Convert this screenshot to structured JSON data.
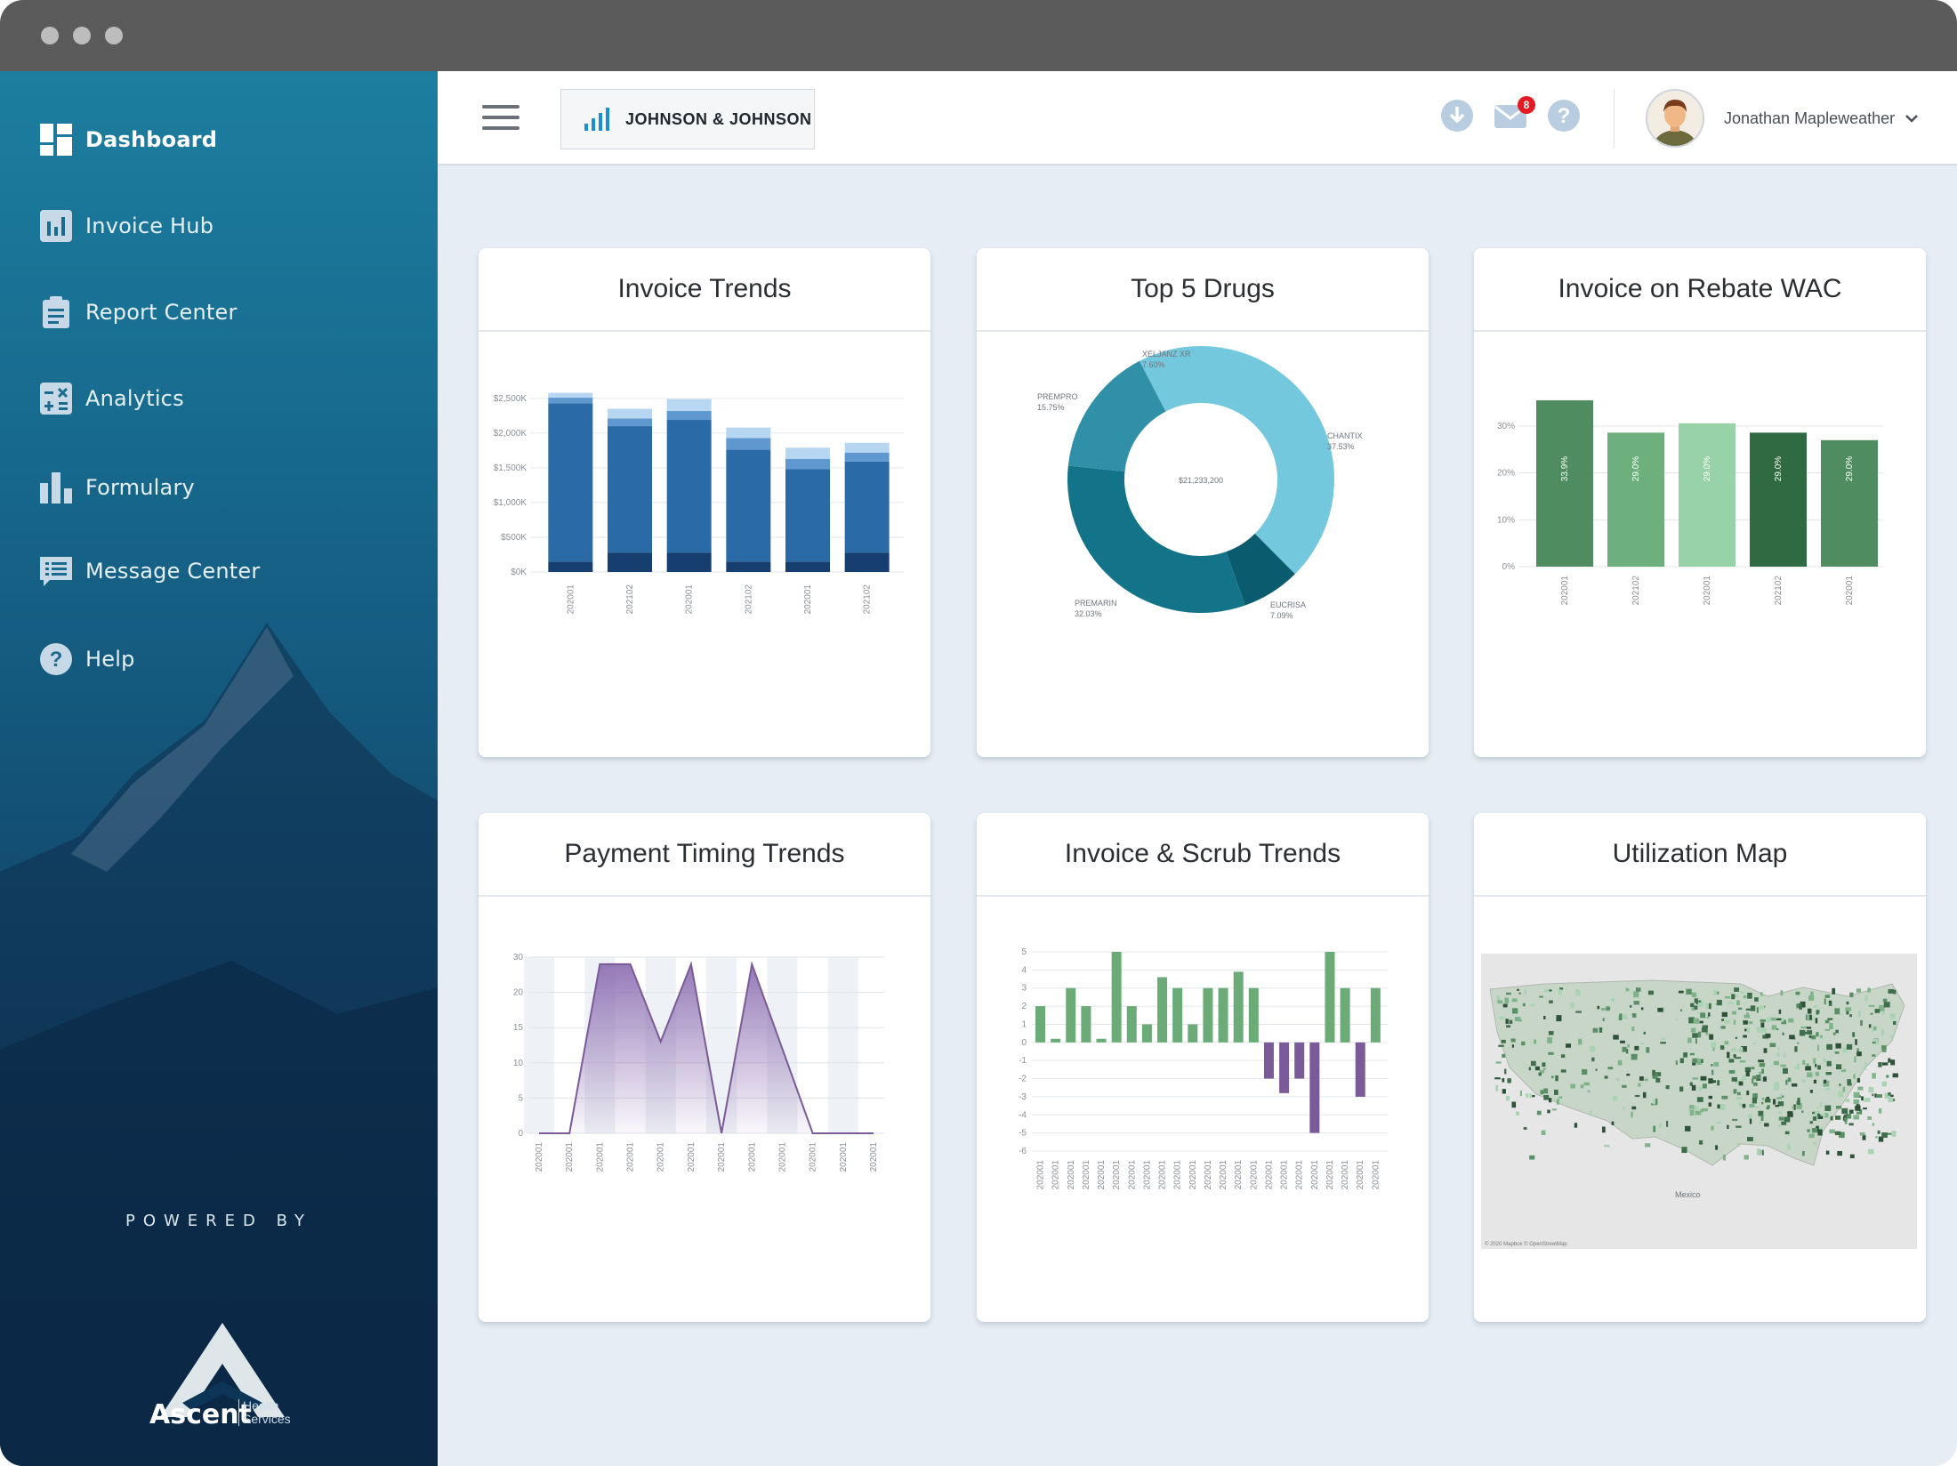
{
  "window": {
    "traffic_lights": [
      "close",
      "minimize",
      "zoom"
    ]
  },
  "sidebar": {
    "items": [
      {
        "label": "Dashboard",
        "icon": "dashboard-icon",
        "active": true
      },
      {
        "label": "Invoice Hub",
        "icon": "invoice-hub-icon",
        "active": false
      },
      {
        "label": "Report Center",
        "icon": "report-center-icon",
        "active": false
      },
      {
        "label": "Analytics",
        "icon": "analytics-icon",
        "active": false
      },
      {
        "label": "Formulary",
        "icon": "formulary-icon",
        "active": false
      },
      {
        "label": "Message Center",
        "icon": "message-center-icon",
        "active": false
      },
      {
        "label": "Help",
        "icon": "help-icon",
        "active": false
      }
    ],
    "powered_by": "POWERED BY",
    "brand": {
      "name": "Ascent",
      "sub_line1": "Health",
      "sub_line2": "Services"
    }
  },
  "header": {
    "company": "JOHNSON & JOHNSON",
    "notifications_count": "8",
    "user_name": "Jonathan Mapleweather",
    "icons": [
      "menu-icon",
      "download-icon",
      "mail-icon",
      "help-circle-icon",
      "chevron-down-icon"
    ]
  },
  "colors": {
    "accent": "#1a8fd0",
    "blue_stack": [
      "#163f70",
      "#2a6aa6",
      "#5f97cf",
      "#b7d6f2"
    ],
    "donut": [
      "#74c8de",
      "#0b5b6e",
      "#137489",
      "#2f90a8"
    ],
    "green_bars": [
      "#4f8c5f",
      "#6daf7d",
      "#97d2a8",
      "#2f6a42",
      "#4f8c5f"
    ],
    "purple": "#8a6bb0",
    "green": "#6bab78",
    "violet": "#7a5a98"
  },
  "cards": [
    {
      "title": "Invoice Trends",
      "chart_data": {
        "type": "bar",
        "stacked": true,
        "categories": [
          "202001",
          "202102",
          "202001",
          "202102",
          "202001",
          "202102"
        ],
        "series": [
          {
            "values": [
              150,
              280,
              280,
              150,
              150,
              280
            ]
          },
          {
            "values": [
              2280,
              1820,
              1910,
              1610,
              1330,
              1310
            ]
          },
          {
            "values": [
              80,
              110,
              130,
              170,
              150,
              130
            ]
          },
          {
            "values": [
              70,
              140,
              170,
              150,
              160,
              140
            ]
          }
        ],
        "y_ticks": [
          "$0K",
          "$500K",
          "$1,000K",
          "$1,500K",
          "$2,000K",
          "$2,500K"
        ],
        "ylim": [
          0,
          2500
        ]
      }
    },
    {
      "title": "Top 5 Drugs",
      "chart_data": {
        "type": "pie",
        "donut": true,
        "center_label": "$21,233,200",
        "slices": [
          {
            "label": "CHANTIX",
            "pct": "37.53%",
            "value": 37.53
          },
          {
            "label": "EUCRISA",
            "pct": "7.09%",
            "value": 7.09
          },
          {
            "label": "PREMARIN",
            "pct": "32.03%",
            "value": 32.03
          },
          {
            "label": "PREMPRO",
            "pct": "15.75%",
            "value": 15.75
          },
          {
            "label": "XELJANZ XR",
            "pct": "7.60%",
            "value": 7.6
          }
        ]
      }
    },
    {
      "title": "Invoice on Rebate WAC",
      "chart_data": {
        "type": "bar",
        "categories": [
          "202001",
          "202102",
          "202001",
          "202102",
          "202001"
        ],
        "values": [
          35.5,
          28.6,
          30.6,
          28.6,
          27.0
        ],
        "value_labels": [
          "33.9%",
          "29.0%",
          "29.0%",
          "29.0%",
          "29.0%"
        ],
        "y_ticks": [
          "0%",
          "10%",
          "20%",
          "30%"
        ],
        "ylim": [
          0,
          36
        ]
      }
    },
    {
      "title": "Payment Timing Trends",
      "chart_data": {
        "type": "area",
        "x": [
          "202001",
          "202001",
          "202001",
          "202001",
          "202001",
          "202001",
          "202001",
          "202001",
          "202001",
          "202001",
          "202001",
          "202001"
        ],
        "values": [
          0,
          0,
          24,
          24,
          13,
          24,
          0,
          24,
          12,
          0,
          0,
          0
        ],
        "y_ticks": [
          "0",
          "5",
          "10",
          "15",
          "20",
          "30"
        ],
        "ylim": [
          0,
          25
        ]
      }
    },
    {
      "title": "Invoice & Scrub Trends",
      "chart_data": {
        "type": "bar",
        "x": [
          "202001",
          "202001",
          "202001",
          "202001",
          "202001",
          "202001",
          "202001",
          "202001",
          "202001",
          "202001",
          "202001",
          "202001",
          "202001",
          "202001",
          "202001",
          "202001",
          "202001",
          "202001",
          "202001",
          "202001",
          "202001",
          "202001",
          "202001"
        ],
        "values": [
          2,
          0.2,
          3,
          2,
          0.2,
          5,
          2,
          1,
          3.6,
          3,
          1,
          3,
          3,
          3.9,
          3,
          -2,
          -2.8,
          -2,
          -5,
          5,
          3,
          -3,
          3
        ],
        "y_ticks": [
          "-6",
          "-5",
          "-4",
          "-3",
          "-2",
          "-1",
          "0",
          "1",
          "2",
          "3",
          "4",
          "5"
        ],
        "ylim": [
          -6,
          5
        ]
      }
    },
    {
      "title": "Utilization Map",
      "map": {
        "labels": [
          "Mexico"
        ],
        "attribution": "© 2020 Mapbox © OpenStreetMap"
      }
    }
  ]
}
